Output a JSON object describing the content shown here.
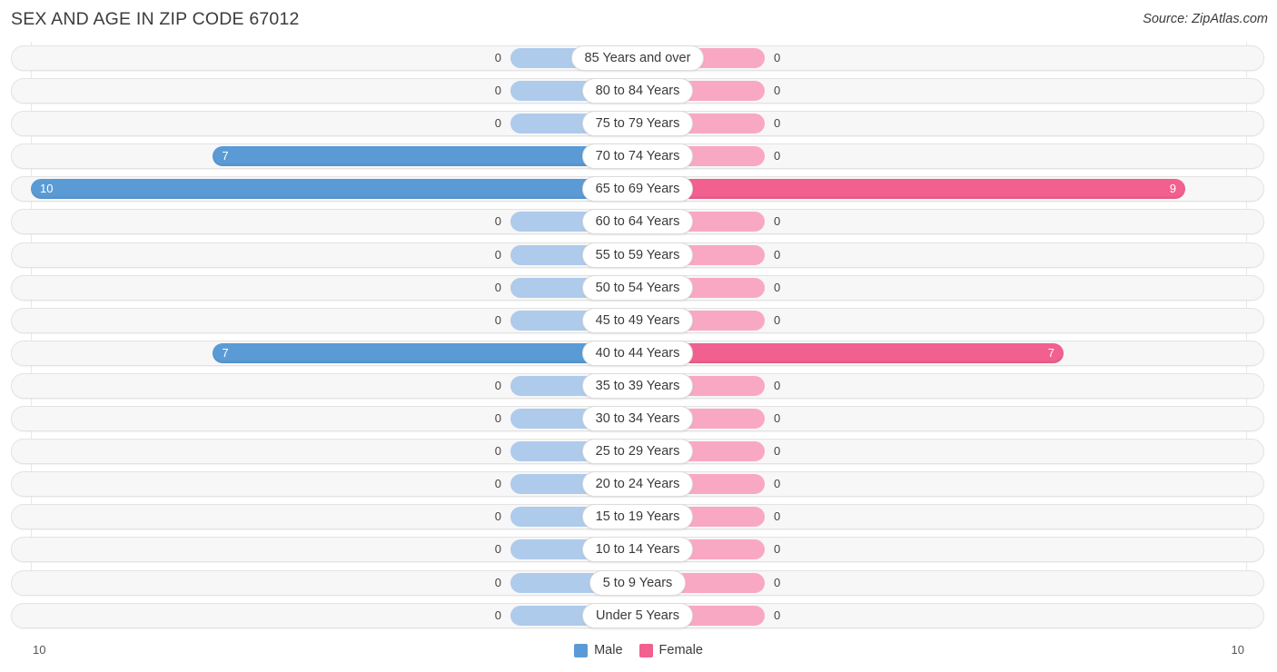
{
  "header": {
    "title": "SEX AND AGE IN ZIP CODE 67012",
    "source": "Source: ZipAtlas.com"
  },
  "legend": {
    "male": {
      "label": "Male",
      "color": "#5b9bd5"
    },
    "female": {
      "label": "Female",
      "color": "#f2608f"
    }
  },
  "axis": {
    "left_end": "10",
    "right_end": "10"
  },
  "colors": {
    "male_bar": "#5b9bd5",
    "female_bar": "#f2608f",
    "male_stub": "#aecbec",
    "female_stub": "#f9a8c4",
    "track": "#f7f7f7",
    "title_text": "#3c3c3c"
  },
  "chart_data": {
    "type": "bar",
    "subtype": "population-pyramid",
    "title": "SEX AND AGE IN ZIP CODE 67012",
    "xlabel": "",
    "ylabel": "",
    "xlim": [
      10,
      10
    ],
    "axis_max": 10,
    "grid": true,
    "legend_position": "bottom-center",
    "categories": [
      "85 Years and over",
      "80 to 84 Years",
      "75 to 79 Years",
      "70 to 74 Years",
      "65 to 69 Years",
      "60 to 64 Years",
      "55 to 59 Years",
      "50 to 54 Years",
      "45 to 49 Years",
      "40 to 44 Years",
      "35 to 39 Years",
      "30 to 34 Years",
      "25 to 29 Years",
      "20 to 24 Years",
      "15 to 19 Years",
      "10 to 14 Years",
      "5 to 9 Years",
      "Under 5 Years"
    ],
    "series": [
      {
        "name": "Male",
        "color": "#5b9bd5",
        "side": "left",
        "values": [
          0,
          0,
          0,
          7,
          10,
          0,
          0,
          0,
          0,
          7,
          0,
          0,
          0,
          0,
          0,
          0,
          0,
          0
        ]
      },
      {
        "name": "Female",
        "color": "#f2608f",
        "side": "right",
        "values": [
          0,
          0,
          0,
          0,
          9,
          0,
          0,
          0,
          0,
          7,
          0,
          0,
          0,
          0,
          0,
          0,
          0,
          0
        ]
      }
    ]
  }
}
